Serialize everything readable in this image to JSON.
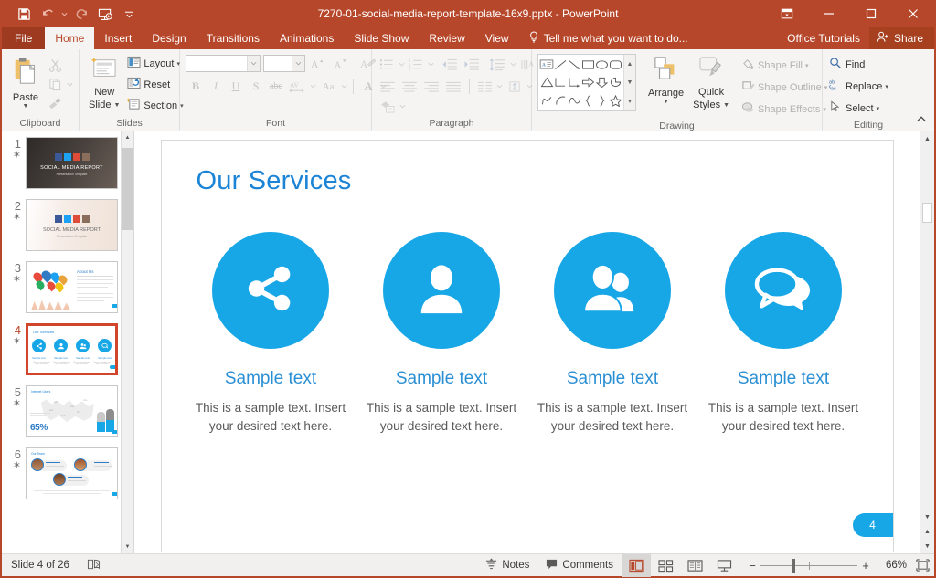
{
  "window": {
    "title": "7270-01-social-media-report-template-16x9.pptx - PowerPoint",
    "quick_access": [
      {
        "name": "save",
        "label": "Save"
      },
      {
        "name": "undo",
        "label": "Undo"
      },
      {
        "name": "redo",
        "label": "Redo"
      },
      {
        "name": "start-presentation",
        "label": "Start From Beginning"
      },
      {
        "name": "customize-qat",
        "label": "Customize Quick Access Toolbar"
      }
    ],
    "controls": [
      {
        "name": "ribbon-display-options",
        "label": "Ribbon Display Options"
      },
      {
        "name": "minimize",
        "label": "Minimize"
      },
      {
        "name": "maximize",
        "label": "Restore Down"
      },
      {
        "name": "close",
        "label": "Close"
      }
    ]
  },
  "tabs": [
    {
      "label": "File",
      "active": false
    },
    {
      "label": "Home",
      "active": true
    },
    {
      "label": "Insert",
      "active": false
    },
    {
      "label": "Design",
      "active": false
    },
    {
      "label": "Transitions",
      "active": false
    },
    {
      "label": "Animations",
      "active": false
    },
    {
      "label": "Slide Show",
      "active": false
    },
    {
      "label": "Review",
      "active": false
    },
    {
      "label": "View",
      "active": false
    }
  ],
  "tellme": {
    "placeholder": "Tell me what you want to do..."
  },
  "account": {
    "office_tutorials": "Office Tutorials",
    "share": "Share"
  },
  "ribbon": {
    "clipboard": {
      "group_label": "Clipboard",
      "paste": "Paste",
      "cut": "Cut",
      "copy": "Copy",
      "format_painter": "Format Painter"
    },
    "slides": {
      "group_label": "Slides",
      "new_slide": "New\nSlide",
      "new_slide_line1": "New",
      "new_slide_line2": "Slide",
      "layout": "Layout",
      "reset": "Reset",
      "section": "Section"
    },
    "font": {
      "group_label": "Font",
      "font_name_value": "",
      "font_size_value": "",
      "increase_size": "Increase Font Size",
      "decrease_size": "Decrease Font Size",
      "clear_formatting": "Clear All Formatting",
      "bold": "B",
      "italic": "I",
      "underline": "U",
      "shadow": "S",
      "strikethrough": "abc",
      "character_spacing": "AV",
      "change_case": "Aa",
      "font_color": "A"
    },
    "paragraph": {
      "group_label": "Paragraph",
      "bullets": "Bullets",
      "numbering": "Numbering",
      "decrease_indent": "Decrease List Level",
      "increase_indent": "Increase List Level",
      "line_spacing": "Line Spacing",
      "text_direction": "Text Direction",
      "align_text": "Align Text",
      "convert_smartart": "Convert to SmartArt",
      "align_left": "Align Left",
      "center": "Center",
      "align_right": "Align Right",
      "justify": "Justify",
      "columns": "Columns"
    },
    "drawing": {
      "group_label": "Drawing",
      "arrange": "Arrange",
      "quick_styles_line1": "Quick",
      "quick_styles_line2": "Styles",
      "shape_fill": "Shape Fill",
      "shape_outline": "Shape Outline",
      "shape_effects": "Shape Effects"
    },
    "editing": {
      "group_label": "Editing",
      "find": "Find",
      "replace": "Replace",
      "select": "Select"
    },
    "collapse": "Collapse the Ribbon"
  },
  "thumbnails": [
    {
      "number": "1",
      "star": "✶",
      "selected": false,
      "kind": "title-dark"
    },
    {
      "number": "2",
      "star": "✶",
      "selected": false,
      "kind": "title-light"
    },
    {
      "number": "3",
      "star": "✶",
      "selected": false,
      "kind": "about-us"
    },
    {
      "number": "4",
      "star": "✶",
      "selected": true,
      "kind": "our-services"
    },
    {
      "number": "5",
      "star": "✶",
      "selected": false,
      "kind": "internet-users"
    },
    {
      "number": "6",
      "star": "✶",
      "selected": false,
      "kind": "our-team"
    }
  ],
  "slide": {
    "title": "Our Services",
    "page_badge": "4",
    "cards": [
      {
        "icon": "share-icon",
        "title": "Sample text",
        "body": "This is a sample text. Insert your desired text here."
      },
      {
        "icon": "person-icon",
        "title": "Sample text",
        "body": "This is a sample text. Insert your desired text here."
      },
      {
        "icon": "group-icon",
        "title": "Sample text",
        "body": "This is a sample text. Insert your desired text here."
      },
      {
        "icon": "chat-bubbles-icon",
        "title": "Sample text",
        "body": "This is a sample text. Insert your desired text here."
      }
    ]
  },
  "statusbar": {
    "slide_indicator": "Slide 4 of 26",
    "accessibility": "Accessibility Checker",
    "notes": "Notes",
    "comments": "Comments",
    "views": [
      {
        "name": "normal-view",
        "label": "Normal",
        "active": true
      },
      {
        "name": "slide-sorter-view",
        "label": "Slide Sorter",
        "active": false
      },
      {
        "name": "reading-view",
        "label": "Reading View",
        "active": false
      },
      {
        "name": "slide-show-view",
        "label": "Slide Show",
        "active": false
      }
    ],
    "zoom_out": "−",
    "zoom_in": "+",
    "zoom_level": "66%",
    "fit_window": "Fit slide to current window"
  },
  "colors": {
    "brand_orange": "#b7472a",
    "accent_blue": "#17a6e6",
    "title_blue": "#1c84d6",
    "card_title_blue": "#2b8fd4",
    "selection_orange": "#d0452b",
    "body_gray": "#5a5a5a"
  }
}
